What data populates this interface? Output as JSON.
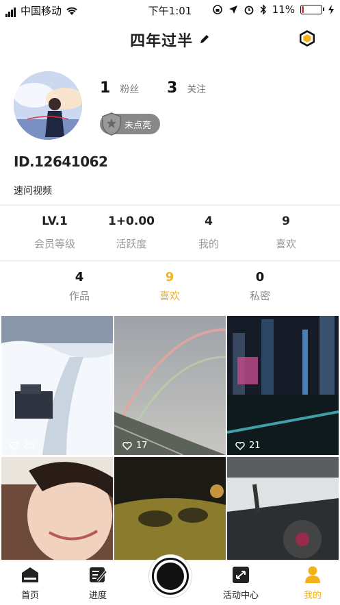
{
  "status_bar": {
    "carrier": "中国移动",
    "time": "下午1:01",
    "battery": "11%",
    "battery_level": 0.11
  },
  "header": {
    "title": "四年过半"
  },
  "profile": {
    "fans_count": "1",
    "fans_label": "粉丝",
    "follow_count": "3",
    "follow_label": "关注",
    "badge_label": "未点亮",
    "user_id": "ID.12641062",
    "bio": "速问视频"
  },
  "stats": [
    {
      "value": "LV.1",
      "label": "会员等级"
    },
    {
      "value": "1+0.00",
      "label": "活跃度"
    },
    {
      "value": "4",
      "label": "我的"
    },
    {
      "value": "9",
      "label": "喜欢"
    }
  ],
  "tabs": [
    {
      "count": "4",
      "label": "作品"
    },
    {
      "count": "9",
      "label": "喜欢"
    },
    {
      "count": "0",
      "label": "私密"
    }
  ],
  "videos": [
    {
      "likes": "25"
    },
    {
      "likes": "17"
    },
    {
      "likes": "21"
    },
    {
      "likes": ""
    },
    {
      "likes": ""
    },
    {
      "likes": ""
    }
  ],
  "nav": {
    "home": "首页",
    "progress": "进度",
    "activity": "活动中心",
    "mine": "我的"
  },
  "colors": {
    "accent": "#f2b21b",
    "battery_low": "#e0403a"
  }
}
